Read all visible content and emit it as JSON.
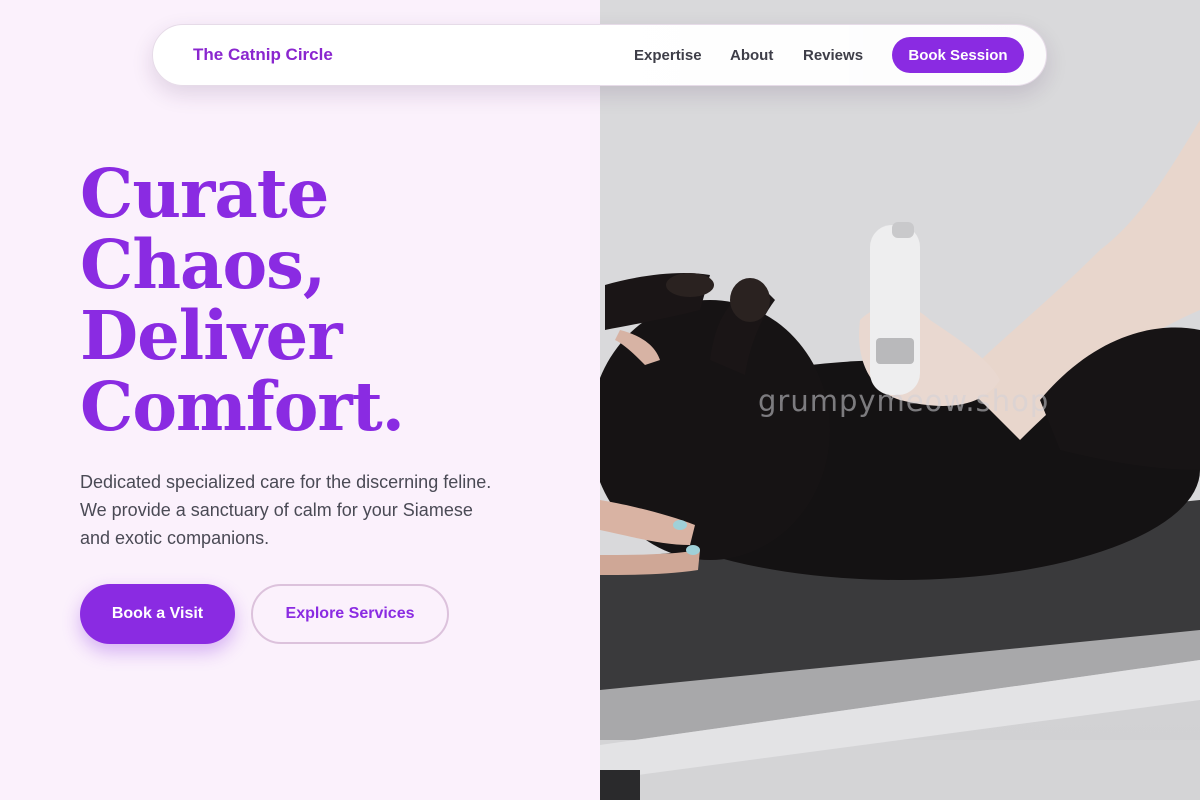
{
  "nav": {
    "brand": "The Catnip Circle",
    "links": [
      {
        "label": "Expertise"
      },
      {
        "label": "About"
      },
      {
        "label": "Reviews"
      }
    ],
    "cta_label": "Book Session"
  },
  "hero": {
    "headline_lines": [
      "Curate",
      "Chaos,",
      "Deliver",
      "Comfort."
    ],
    "description": "Dedicated specialized care for the discerning feline. We provide a sanctuary of calm for your Siamese and exotic companions.",
    "primary_cta": "Book a Visit",
    "secondary_cta": "Explore Services"
  },
  "photo": {
    "watermark": "grumpymeow.shop"
  },
  "colors": {
    "accent": "#8a2be2",
    "page_background": "#fbf1fc",
    "body_text": "#4a4a55",
    "nav_text": "#3e3e48"
  }
}
